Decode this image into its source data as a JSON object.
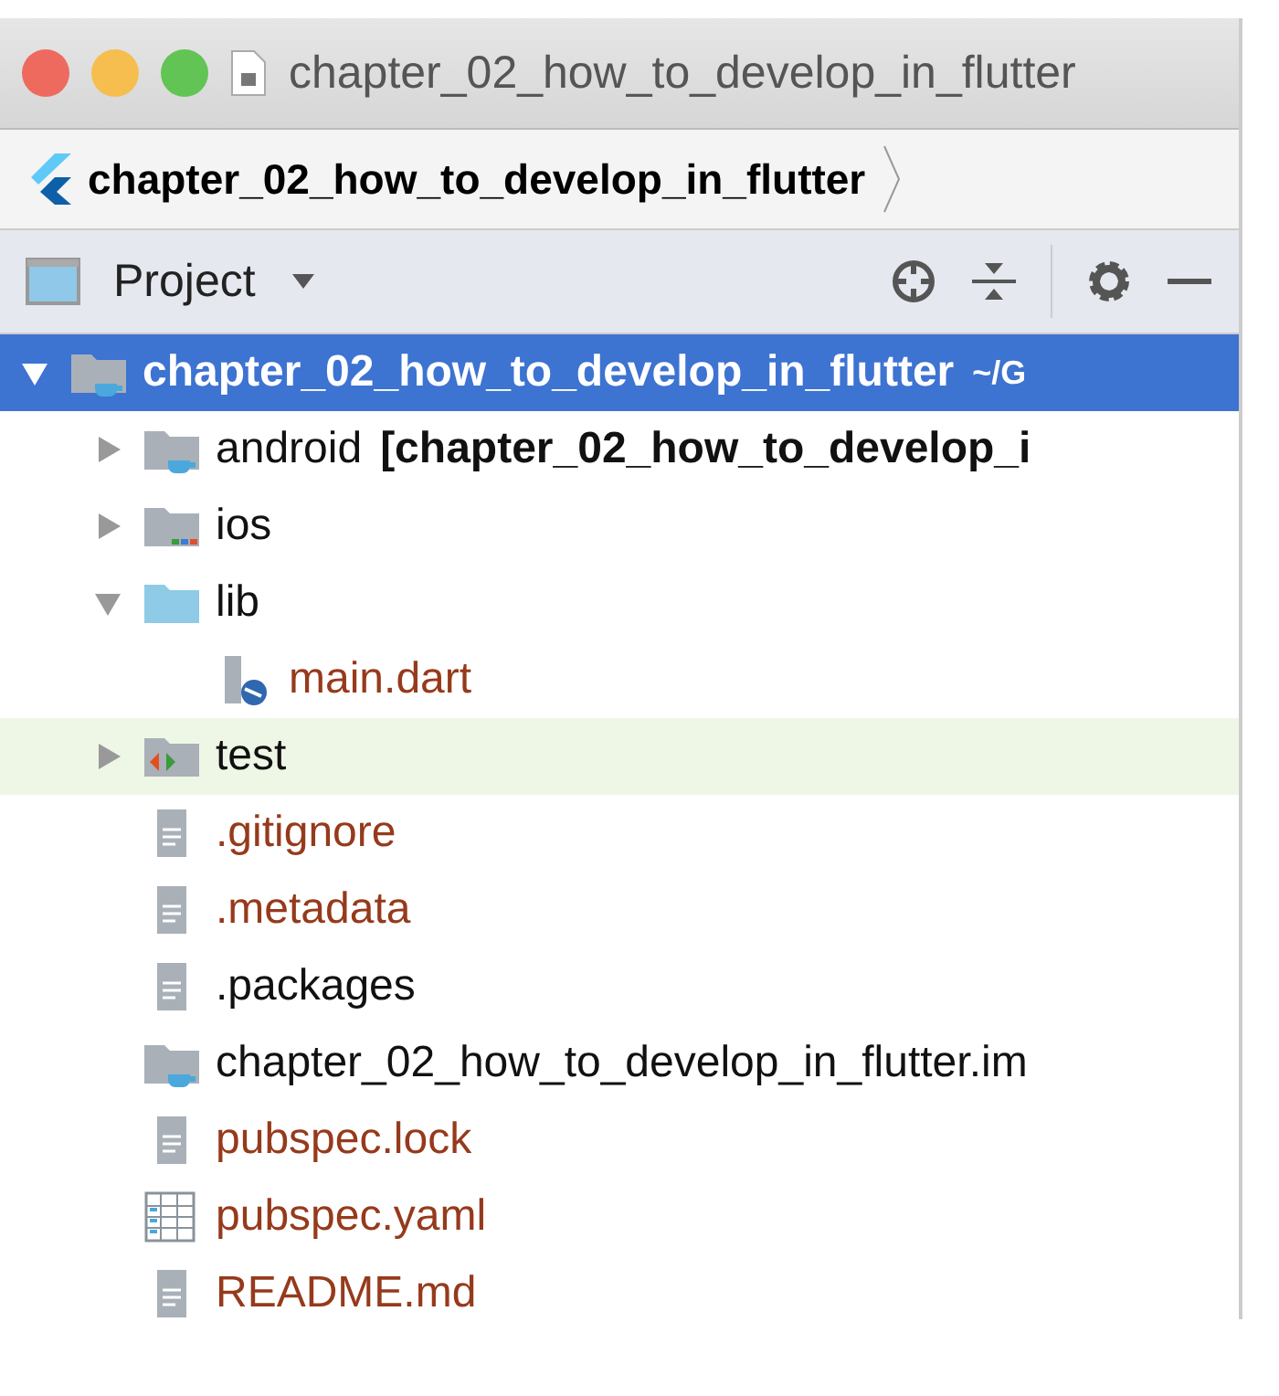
{
  "window": {
    "title": "chapter_02_how_to_develop_in_flutter"
  },
  "breadcrumb": {
    "label": "chapter_02_how_to_develop_in_flutter"
  },
  "toolbar": {
    "view": "Project"
  },
  "tree": [
    {
      "label": "chapter_02_how_to_develop_in_flutter",
      "suffix": "~/G",
      "kind": "module",
      "expanded": true,
      "selected": true,
      "highlighted": false,
      "untracked": false,
      "children": [
        {
          "label": "android",
          "suffix": "[chapter_02_how_to_develop_i",
          "kind": "module",
          "expanded": false,
          "selected": false,
          "highlighted": false,
          "untracked": false
        },
        {
          "label": "ios",
          "kind": "ios",
          "expanded": false,
          "selected": false,
          "highlighted": false,
          "untracked": false
        },
        {
          "label": "lib",
          "kind": "folder",
          "expanded": true,
          "selected": false,
          "highlighted": false,
          "untracked": false,
          "children": [
            {
              "label": "main.dart",
              "kind": "dart",
              "selected": false,
              "highlighted": false,
              "untracked": true
            }
          ]
        },
        {
          "label": "test",
          "kind": "test",
          "expanded": false,
          "selected": false,
          "highlighted": true,
          "untracked": false
        },
        {
          "label": ".gitignore",
          "kind": "text",
          "selected": false,
          "highlighted": false,
          "untracked": true
        },
        {
          "label": ".metadata",
          "kind": "text",
          "selected": false,
          "highlighted": false,
          "untracked": true
        },
        {
          "label": ".packages",
          "kind": "text",
          "selected": false,
          "highlighted": false,
          "untracked": false
        },
        {
          "label": "chapter_02_how_to_develop_in_flutter.im",
          "kind": "module",
          "selected": false,
          "highlighted": false,
          "untracked": false
        },
        {
          "label": "pubspec.lock",
          "kind": "text",
          "selected": false,
          "highlighted": false,
          "untracked": true
        },
        {
          "label": "pubspec.yaml",
          "kind": "yaml",
          "selected": false,
          "highlighted": false,
          "untracked": true
        },
        {
          "label": "README.md",
          "kind": "text",
          "selected": false,
          "highlighted": false,
          "untracked": true
        }
      ]
    }
  ]
}
